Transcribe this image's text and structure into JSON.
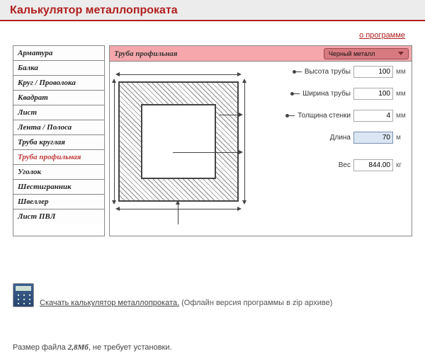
{
  "header": {
    "title": "Калькулятор металлопроката"
  },
  "about_link": "о программе",
  "sidebar": {
    "items": [
      {
        "label": "Арматура",
        "selected": false
      },
      {
        "label": "Балка",
        "selected": false
      },
      {
        "label": "Круг / Проволока",
        "selected": false
      },
      {
        "label": "Квадрат",
        "selected": false
      },
      {
        "label": "Лист",
        "selected": false
      },
      {
        "label": "Лента / Полоса",
        "selected": false
      },
      {
        "label": "Труба круглая",
        "selected": false
      },
      {
        "label": "Труба профильная",
        "selected": true
      },
      {
        "label": "Уголок",
        "selected": false
      },
      {
        "label": "Шестигранник",
        "selected": false
      },
      {
        "label": "Швеллер",
        "selected": false
      },
      {
        "label": "Лист ПВЛ",
        "selected": false
      }
    ]
  },
  "panel": {
    "title": "Труба профильная",
    "material": "Черный металл",
    "fields": {
      "height": {
        "label": "Высота трубы",
        "value": "100",
        "unit": "мм"
      },
      "width": {
        "label": "Ширина трубы",
        "value": "100",
        "unit": "мм"
      },
      "wall": {
        "label": "Толщина стенки",
        "value": "4",
        "unit": "мм"
      },
      "length": {
        "label": "Длина",
        "value": "70",
        "unit": "м"
      },
      "weight": {
        "label": "Вес",
        "value": "844.00",
        "unit": "кг"
      }
    }
  },
  "download": {
    "link_text": "Скачать калькулятор металлопроката.",
    "note": "(Офлайн версия программы в zip архиве)"
  },
  "filesize": {
    "prefix": "Размер файла ",
    "size": "2,8Мб",
    "suffix": ", не требует установки."
  }
}
